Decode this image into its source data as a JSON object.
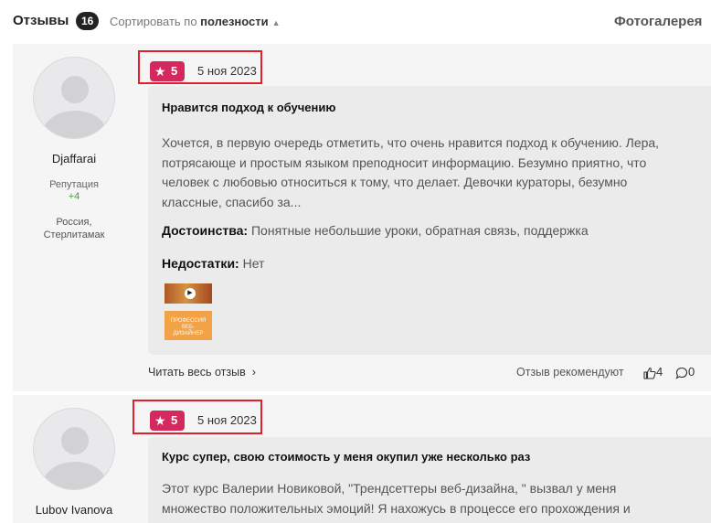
{
  "header": {
    "title": "Отзывы",
    "count": "16",
    "sort_prefix": "Сортировать по ",
    "sort_value": "полезности",
    "gallery": "Фотогалерея"
  },
  "reviews": [
    {
      "user": {
        "name": "Djaffarai",
        "reputation_label": "Репутация",
        "reputation_value": "+4",
        "location_line1": "Россия,",
        "location_line2": "Стерлитамак"
      },
      "rating": "5",
      "date": "5 ноя 2023",
      "title": "Нравится подход к обучению",
      "text": "Хочется, в первую очередь отметить, что очень нравится подход к обучению. Лера, потрясающе и простым языком преподносит информацию. Безумно приятно, что человек с любовью относиться к тому, что делает. Девочки кураторы, безумно классные, спасибо за...",
      "pros_label": "Достоинства:",
      "pros": " Понятные небольшие уроки, обратная связь, поддержка",
      "cons_label": "Недостатки:",
      "cons": " Нет",
      "thumb2_text": "ПРОФЕССИЯ ВЕБ-ДИЗАЙНЕР",
      "read_all": "Читать весь отзыв",
      "recommend": "Отзыв рекомендуют",
      "likes": "4",
      "comments": "0"
    },
    {
      "user": {
        "name": "Lubov Ivanova"
      },
      "rating": "5",
      "date": "5 ноя 2023",
      "title": "Курс супер, свою стоимость у меня окупил уже несколько раз",
      "text": "Этот курс Валерии Новиковой, \"Трендсеттеры веб-дизайна, \" вызвал у меня множество положительных эмоций! Я нахожусь в процессе его прохождения и"
    }
  ],
  "colors": {
    "badge": "#d3295d",
    "highlight_border": "#e0212b",
    "reputation": "#39a33a"
  }
}
